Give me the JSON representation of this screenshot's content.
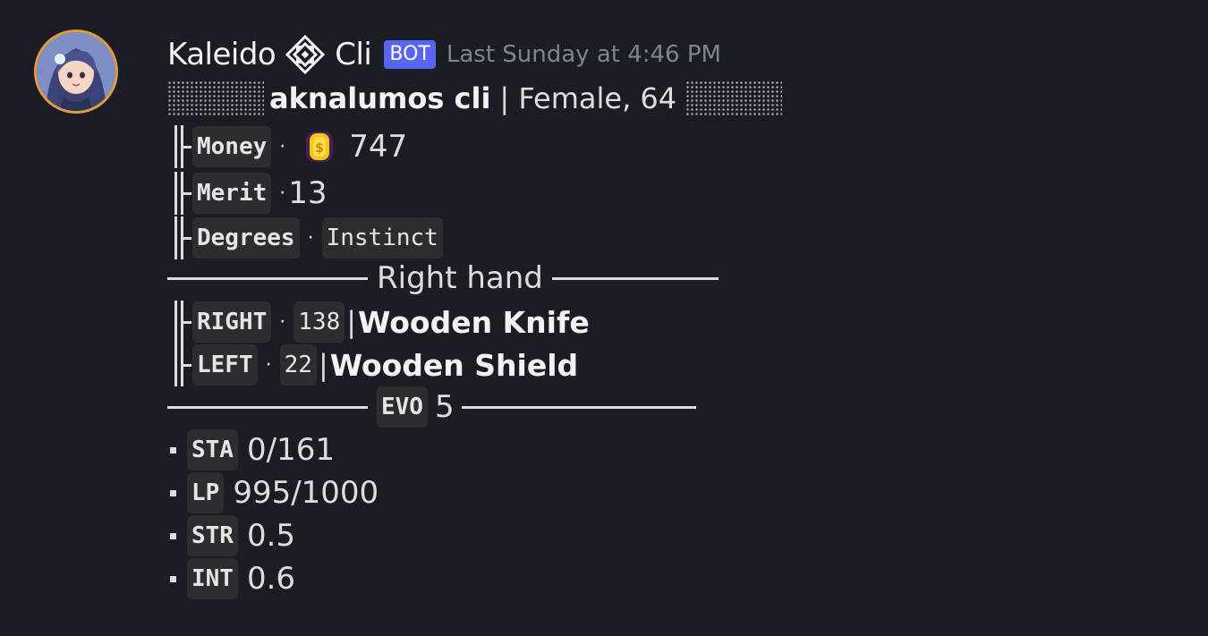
{
  "header": {
    "username_left": "Kaleido",
    "username_right": "Cli",
    "bot_tag": "BOT",
    "timestamp": "Last Sunday at 4:46 PM"
  },
  "profile": {
    "name": "aknalumos cli",
    "details": "| Female, 64"
  },
  "stats": {
    "money_label": "Money",
    "money_value": "747",
    "merit_label": "Merit",
    "merit_value": "13",
    "degrees_label": "Degrees",
    "degrees_value": "Instinct"
  },
  "right_hand": {
    "title": "Right hand",
    "right_label": "RIGHT",
    "right_num": "138",
    "right_item": "Wooden Knife",
    "left_label": "LEFT",
    "left_num": "22",
    "left_item": "Wooden Shield"
  },
  "evo": {
    "label": "EVO",
    "value": "5"
  },
  "attributes": [
    {
      "label": "STA",
      "value": "0/161"
    },
    {
      "label": "LP",
      "value": "995/1000"
    },
    {
      "label": "STR",
      "value": "0.5"
    },
    {
      "label": "INT",
      "value": "0.6"
    }
  ],
  "colors": {
    "background": "#1b1d25",
    "bot_tag": "#5865f2",
    "avatar_ring": "#e29a3f"
  }
}
